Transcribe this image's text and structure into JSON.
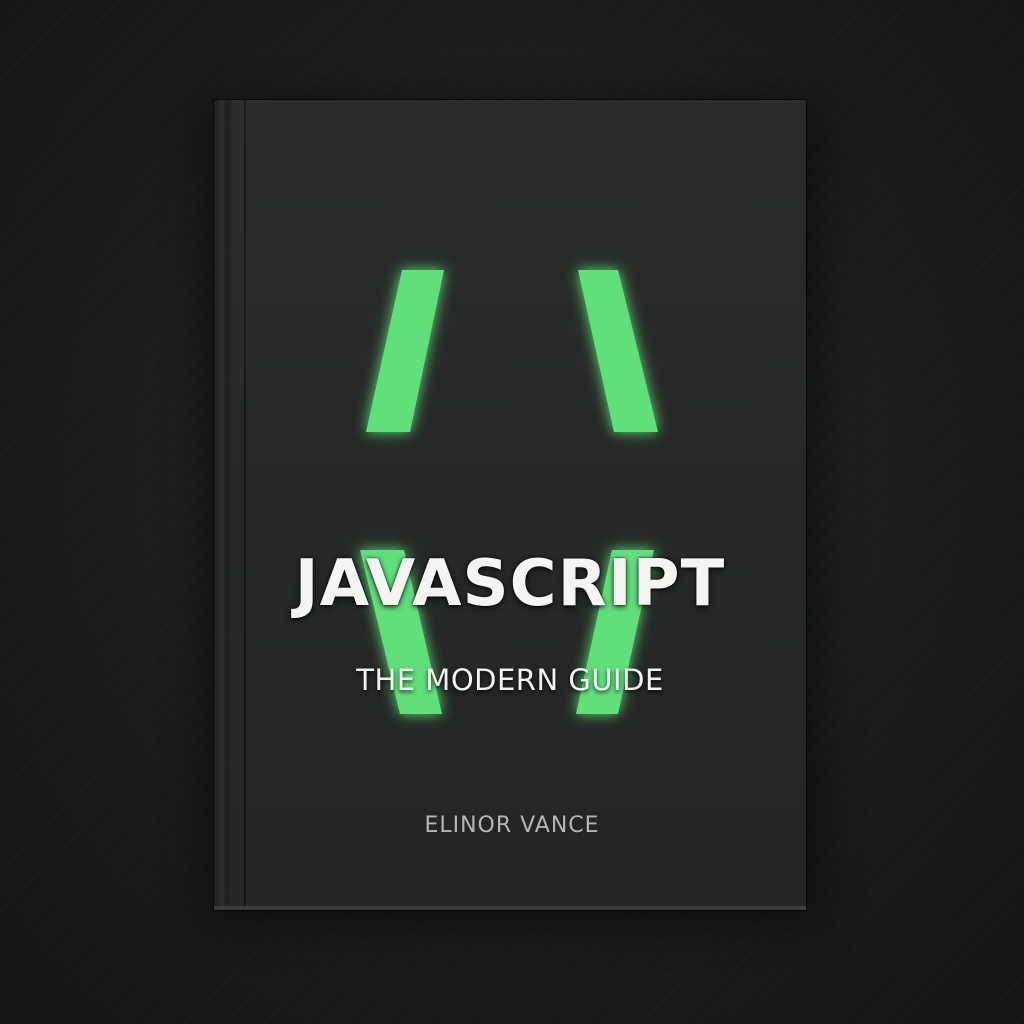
{
  "book": {
    "title": "JAVASCRIPT",
    "subtitle": "THE MODERN GUIDE",
    "author": "ELINOR VANCE"
  },
  "colors": {
    "background": "#1b1c1c",
    "cover": "#272a28",
    "accent_green": "#5fe07a",
    "title_text": "#f4f4f2",
    "author_text": "#b4b6b3"
  }
}
